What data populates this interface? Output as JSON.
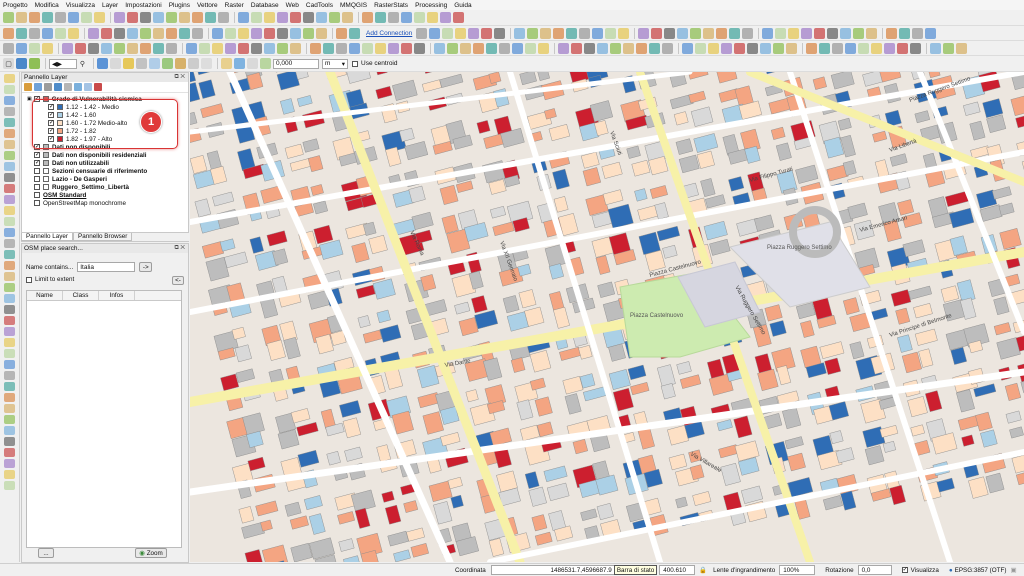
{
  "menu": [
    "Progetto",
    "Modifica",
    "Visualizza",
    "Layer",
    "Impostazioni",
    "Plugins",
    "Vettore",
    "Raster",
    "Database",
    "Web",
    "CadTools",
    "MMQGIS",
    "RasterStats",
    "Processing",
    "Guida"
  ],
  "toolbar": {
    "add_connection": "Add Connection",
    "coord_input": "0,000",
    "unit_select": "m",
    "use_centroid": "Use centroid"
  },
  "layer_panel": {
    "title": "Pannello Layer",
    "group_title": "Grado di Vulnerabilità sismica",
    "legend": [
      {
        "label": "1.12 - 1.42 - Medio",
        "color": "#2f6db5"
      },
      {
        "label": "1.42 - 1.60",
        "color": "#abd0e6"
      },
      {
        "label": "1.60 - 1.72 Medio-alto",
        "color": "#fde0c5"
      },
      {
        "label": "1.72 - 1.82",
        "color": "#f4a582"
      },
      {
        "label": "1.82 - 1.97 - Alto",
        "color": "#cc1f2f"
      }
    ],
    "layers": [
      {
        "label": "Dati non disponibili",
        "checked": true
      },
      {
        "label": "Dati non disponibili residenziali",
        "checked": true
      },
      {
        "label": "Dati non utilizzabili",
        "checked": true
      },
      {
        "label": "Sezioni censuarie di riferimento",
        "checked": false
      },
      {
        "label": "Lazio - De Gasperi",
        "checked": false
      },
      {
        "label": "Ruggero_Settimo_Libertà",
        "checked": false
      },
      {
        "label": "OSM Standard",
        "checked": false
      },
      {
        "label": "OpenStreetMap monochrome",
        "checked": false
      }
    ],
    "badge": "1"
  },
  "panel_tabs": [
    "Pannello Layer",
    "Pannello Browser"
  ],
  "osm_panel": {
    "title": "OSM place search...",
    "name_contains_label": "Name contains...",
    "name_value": "Italia",
    "go_button": "->",
    "limit_to_extent": "Limit to extent",
    "back_button": "<-",
    "columns": [
      "Name",
      "Class",
      "Infos"
    ],
    "more_button": "...",
    "zoom_button": "Zoom"
  },
  "map": {
    "street_labels": [
      "Via Dante",
      "Via Villareale",
      "Via Roma",
      "Via Principe di Belmonte",
      "Via Emerico Amari",
      "Via Filippo Turati",
      "Via Ruggero Settimo",
      "Piazza Castelnuovo",
      "Piazza Ruggero Settimo",
      "Via Libertà",
      "Via XII Gennaio",
      "Via Sciuti"
    ],
    "place_labels": [
      "Piazza Castelnuovo",
      "Piazza Ruggero Settimo"
    ]
  },
  "statusbar": {
    "coord_label": "Coordinata",
    "coord_value": "1486531.7,4596687.9",
    "tooltip": "Barra di stato",
    "scale_value": "400.610",
    "magnifier_label": "Lente d'ingrandimento",
    "magnifier_value": "100%",
    "rotation_label": "Rotazione",
    "rotation_value": "0,0",
    "render_label": "Visualizza",
    "crs": "EPSG:3857 (OTF)"
  }
}
